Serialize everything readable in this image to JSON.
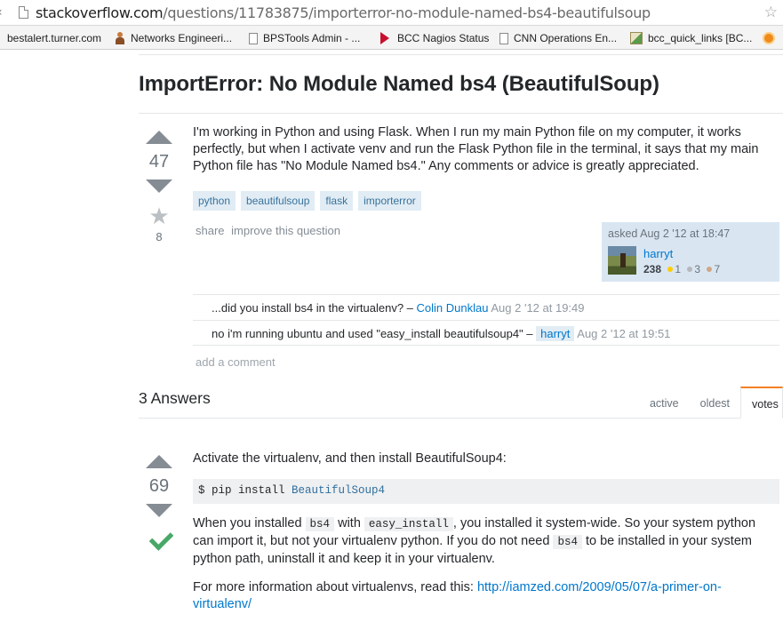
{
  "browser": {
    "url_host": "stackoverflow.com",
    "url_path": "/questions/11783875/importerror-no-module-named-bs4-beautifulsoup",
    "bookmarks": [
      {
        "label": "bestalert.turner.com",
        "icon": "none"
      },
      {
        "label": "Networks Engineeri...",
        "icon": "person-icon"
      },
      {
        "label": "BPSTools Admin - ...",
        "icon": "page-icon"
      },
      {
        "label": "BCC Nagios Status",
        "icon": "nagios-icon"
      },
      {
        "label": "CNN Operations En...",
        "icon": "page-icon"
      },
      {
        "label": "bcc_quick_links [BC...",
        "icon": "links-icon"
      }
    ]
  },
  "question": {
    "title": "ImportError: No Module Named bs4 (BeautifulSoup)",
    "votes": "47",
    "favorites": "8",
    "body": "I'm working in Python and using Flask. When I run my main Python file on my computer, it works perfectly, but when I activate venv and run the Flask Python file in the terminal, it says that my main Python file has \"No Module Named bs4.\" Any comments or advice is greatly appreciated.",
    "tags": [
      "python",
      "beautifulsoup",
      "flask",
      "importerror"
    ],
    "menu": {
      "share": "share",
      "improve": "improve this question"
    },
    "owner": {
      "asked_label": "asked Aug 2 '12 at 18:47",
      "name": "harryt",
      "reputation": "238",
      "gold": "1",
      "silver": "3",
      "bronze": "7"
    },
    "comments": [
      {
        "text": "...did you install bs4 in the virtualenv? – ",
        "user": "Colin Dunklau",
        "date": "Aug 2 '12 at 19:49",
        "owner": false
      },
      {
        "text": "no i'm running ubuntu and used \"easy_install beautifulsoup4\" – ",
        "user": "harryt",
        "date": "Aug 2 '12 at 19:51",
        "owner": true
      }
    ],
    "add_comment": "add a comment"
  },
  "answers": {
    "count_label": "3 Answers",
    "sort_tabs": [
      {
        "label": "active",
        "selected": false
      },
      {
        "label": "oldest",
        "selected": false
      },
      {
        "label": "votes",
        "selected": true
      }
    ],
    "top_answer": {
      "votes": "69",
      "accepted": true,
      "intro": "Activate the virtualenv, and then install BeautifulSoup4:",
      "code_prefix": "$ pip install ",
      "code_package": "BeautifulSoup4",
      "p1_a": "When you installed ",
      "p1_code1": "bs4",
      "p1_b": " with ",
      "p1_code2": "easy_install",
      "p1_c": ", you installed it system-wide. So your system python can import it, but not your virtualenv python. If you do not need ",
      "p1_code3": "bs4",
      "p1_d": " to be installed in your system python path, uninstall it and keep it in your virtualenv.",
      "p2_text": "For more information about virtualenvs, read this: ",
      "p2_link": "http://iamzed.com/2009/05/07/a-primer-on-virtualenv/"
    }
  },
  "colors": {
    "link": "#0077cc",
    "tag_bg": "#e1ecf4",
    "tag_text": "#39739d",
    "accepted": "#48a868",
    "owner_card": "#d9e6f2",
    "sort_accent": "#f48024"
  }
}
